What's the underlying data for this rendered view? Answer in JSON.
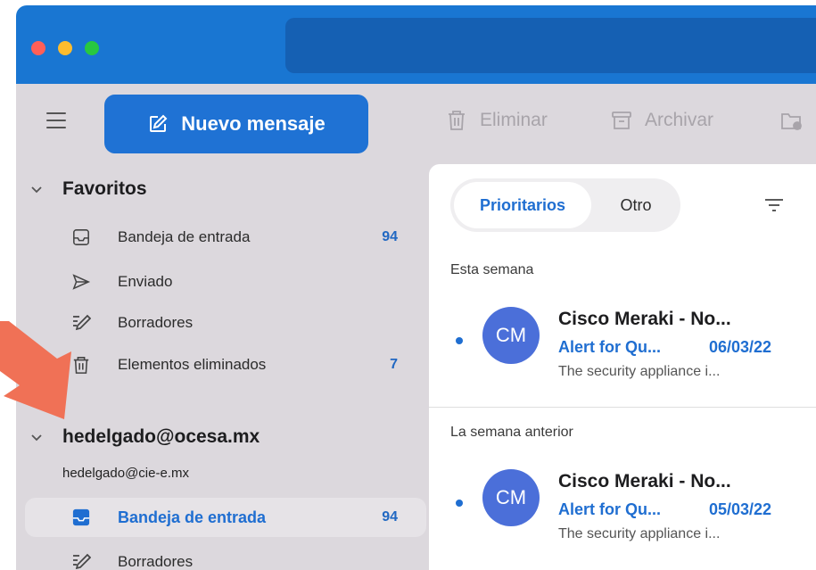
{
  "window": {
    "controls": [
      "close",
      "minimize",
      "zoom"
    ]
  },
  "toolbar": {
    "menu_icon": "hamburger-icon",
    "new_message_label": "Nuevo mensaje",
    "delete_label": "Eliminar",
    "archive_label": "Archivar"
  },
  "sidebar": {
    "favorites": {
      "title": "Favoritos",
      "folders": [
        {
          "label": "Bandeja de entrada",
          "count": "94",
          "icon": "inbox-icon"
        },
        {
          "label": "Enviado",
          "count": "",
          "icon": "send-icon"
        },
        {
          "label": "Borradores",
          "count": "",
          "icon": "drafts-icon"
        },
        {
          "label": "Elementos eliminados",
          "count": "7",
          "icon": "trash-icon"
        }
      ]
    },
    "account": {
      "title": "hedelgado@ocesa.mx",
      "subtitle": "hedelgado@cie-e.mx",
      "folders": [
        {
          "label": "Bandeja de entrada",
          "count": "94",
          "icon": "inbox-icon",
          "active": true
        },
        {
          "label": "Borradores",
          "count": "",
          "icon": "drafts-icon"
        }
      ]
    }
  },
  "message_list": {
    "tabs": [
      {
        "label": "Prioritarios",
        "selected": true
      },
      {
        "label": "Otro",
        "selected": false
      }
    ],
    "groups": [
      {
        "header": "Esta semana",
        "messages": [
          {
            "avatar": "CM",
            "sender": "Cisco Meraki - No...",
            "subject": "Alert for Qu...",
            "date": "06/03/22",
            "preview": "The security appliance i...",
            "unread": true
          }
        ]
      },
      {
        "header": "La semana anterior",
        "messages": [
          {
            "avatar": "CM",
            "sender": "Cisco Meraki - No...",
            "subject": "Alert for Qu...",
            "date": "05/03/22",
            "preview": "The security appliance i...",
            "unread": true
          }
        ]
      }
    ]
  },
  "colors": {
    "accent": "#1f72d4",
    "titlebar": "#1976d2",
    "sidebar_bg": "#dcd8dd",
    "annotation_arrow": "#f07156"
  }
}
